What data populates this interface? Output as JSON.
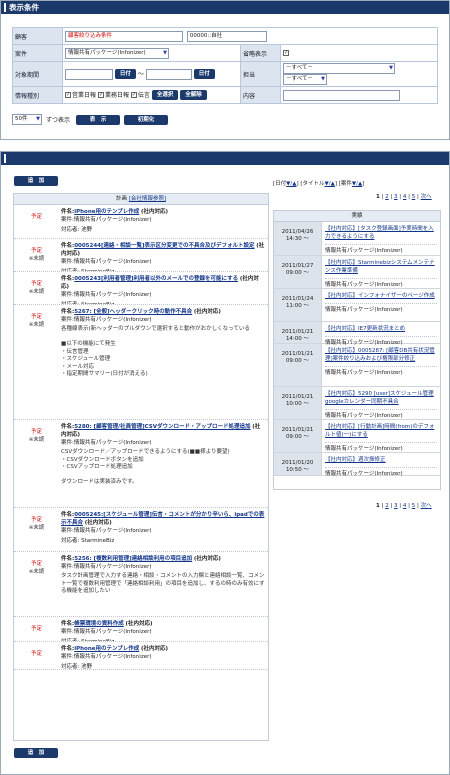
{
  "conditions": {
    "header": "表示条件",
    "customer_label": "顧客",
    "customer_filter": "顧客絞り込み条件",
    "customer_value": "00000::自社",
    "project_label": "案件",
    "project_value": "情報共有パッケージ(Infonizer)",
    "omit_label": "省略表示",
    "period_label": "対象期間",
    "date_button": "日付",
    "tilde": "～",
    "owner_label": "担当",
    "owner_value1": "－すべて－",
    "owner_value2": "－すべて－",
    "kind_label": "情報種別",
    "kinds": [
      "営業日報",
      "業務日報",
      "伝言"
    ],
    "select_all": "全選択",
    "clear_all": "全解除",
    "content_label": "内容",
    "count_value": "50件",
    "per_page": "ずつ表示",
    "show_button": "表　示",
    "reset_button": "初期化"
  },
  "list": {
    "add_label": "追　加",
    "plan_header": "計画",
    "company_info_link": "[会社情報参照]",
    "sort_date": "日付",
    "sort_title": "タイトル",
    "sort_project": "案件",
    "arrows": "▼/▲",
    "pages": [
      "1",
      "2",
      "3",
      "4",
      "5"
    ],
    "next": "次へ",
    "result_header": "実績",
    "plan_items": [
      {
        "status": "予定",
        "sub": "",
        "title": "件名:",
        "title_text": "iPhone用のテンプレ作成",
        "suffix": "(社内対応)",
        "project": "案件:情報共有パッケージ(Infonizer)",
        "owner": "対応者: 池野",
        "body": ""
      },
      {
        "status": "予定",
        "sub": "※未読",
        "title": "件名:",
        "title_text": "0005244[連絡・相談一覧]表示区分変更での不具合及びデフォルト設定",
        "suffix": "(社内対応)",
        "project": "案件:情報共有パッケージ(Infonizer)",
        "owner": "対応者: StarmineBiz",
        "body": ""
      },
      {
        "status": "予定",
        "sub": "※未読",
        "title": "件名:",
        "title_text": "0005243[利用者管理]利用者以外のメールでの登録を可能にする",
        "suffix": "(社内対応)",
        "project": "案件:情報共有パッケージ(Infonizer)",
        "owner": "対応者: StarmineBiz",
        "body": ""
      },
      {
        "status": "予定",
        "sub": "※未読",
        "title": "件名:",
        "title_text": "5267: [全般]ヘッダークリック時の動作不具合",
        "suffix": "(社内対応)",
        "project": "案件:情報共有パッケージ(Infonizer)",
        "owner": "",
        "body": "各種線表示(新ヘッダーのプルダウンで選択すると動作がおかしくなっている\n\n■以下の機能にて発生\n・伝言管理\n・スケジュール管理\n・メール対応\n・指定期間サマリー(日付が消える)"
      },
      {
        "status": "予定",
        "sub": "※未読",
        "title": "件名:",
        "title_text": "5280: [顧客管理/社員管理]CSVダウンロード・アップロード処理追加",
        "suffix": "(社内対応)",
        "project": "案件:情報共有パッケージ(Infonizer)",
        "owner": "",
        "body": "CSVダウンロード／アップロードできるようにする(■■様より要望)\n・CSVダウンロードボタンを追加\n・CSVアップロード処理追加\n\nダウンロードは実装済みです。"
      },
      {
        "status": "予定",
        "sub": "※未読",
        "title": "件名:",
        "title_text": "0005245:[スケジュール管理]伝言・コメントが分かり辛いら、ipadでの表示不具合",
        "suffix": "(社内対応)",
        "project": "案件:情報共有パッケージ(Infonizer)",
        "owner": "対応者: StarmineBiz",
        "body": ""
      },
      {
        "status": "予定",
        "sub": "※未読",
        "title": "件名:",
        "title_text": "5256: [複数利用管理]連絡相談利用の項目追加",
        "suffix": "(社内対応)",
        "project": "案件:情報共有パッケージ(Infonizer)",
        "owner": "",
        "body": "タスク計画管理で入力する連絡・相談・コメントの入力欄と連絡相談一覧、コメント一覧で複数利用管理で「連絡相談利用」の項目を追加し、するの時のみ有効にする機能を追加したい"
      },
      {
        "status": "予定",
        "sub": "",
        "title": "件名:",
        "title_text": "帳票環境の資料作成",
        "suffix": "(社内対応)",
        "project": "案件:情報共有パッケージ(Infonizer)",
        "owner": "対応者: StarmineBiz",
        "body": ""
      },
      {
        "status": "予定",
        "sub": "",
        "title": "件名:",
        "title_text": "iPhone用のテンプレ作成",
        "suffix": "(社内対応)",
        "project": "案件:情報共有パッケージ(Infonizer)",
        "owner": "対応者: 池野",
        "body": ""
      }
    ],
    "result_items": [
      {
        "date": "2011/04/26",
        "time": "14:30 ～",
        "title": "【社内対応】[タスク登録画面]予実時間を入力できるようにする",
        "project": "情報共有パッケージ(Infonizer)"
      },
      {
        "date": "2011/01/27",
        "time": "09:00 ～",
        "title": "【社内対応】Starminebizシステムメンテナンス作業準備",
        "project": "情報共有パッケージ(Infonizer)"
      },
      {
        "date": "2011/01/24",
        "time": "11:00 ～",
        "title": "【社内対応】インフォナイザーのページ作成",
        "project": "情報共有パッケージ(Infonizer)"
      },
      {
        "date": "2011/01/21",
        "time": "14:00 ～",
        "title": "【社内対応】IE7更新状況まとめ",
        "project": "情報共有パッケージ(Infonizer)"
      },
      {
        "date": "2011/01/21",
        "time": "09:00 ～",
        "title": "【社内対応】0005287: [顧客DB共有状況管理]案件絞り込みおよび権限部分修正",
        "project": "情報共有パッケージ(Infonizer)"
      },
      {
        "date": "2011/01/21",
        "time": "10:00 ～",
        "title": "【社内対応】5290 [user]スケジュール管理 googleカレンダー同期不具合",
        "project": "情報共有パッケージ(Infonizer)"
      },
      {
        "date": "2011/01/21",
        "time": "09:00 ～",
        "title": "【社内対応】[行動計画]時間(from)のデフォルト値(一)にする",
        "project": "情報共有パッケージ(Infonizer)"
      },
      {
        "date": "2011/01/20",
        "time": "10:50 ～",
        "title": "【社内対応】週次振修正",
        "project": "情報共有パッケージ(Infonizer)"
      }
    ]
  }
}
